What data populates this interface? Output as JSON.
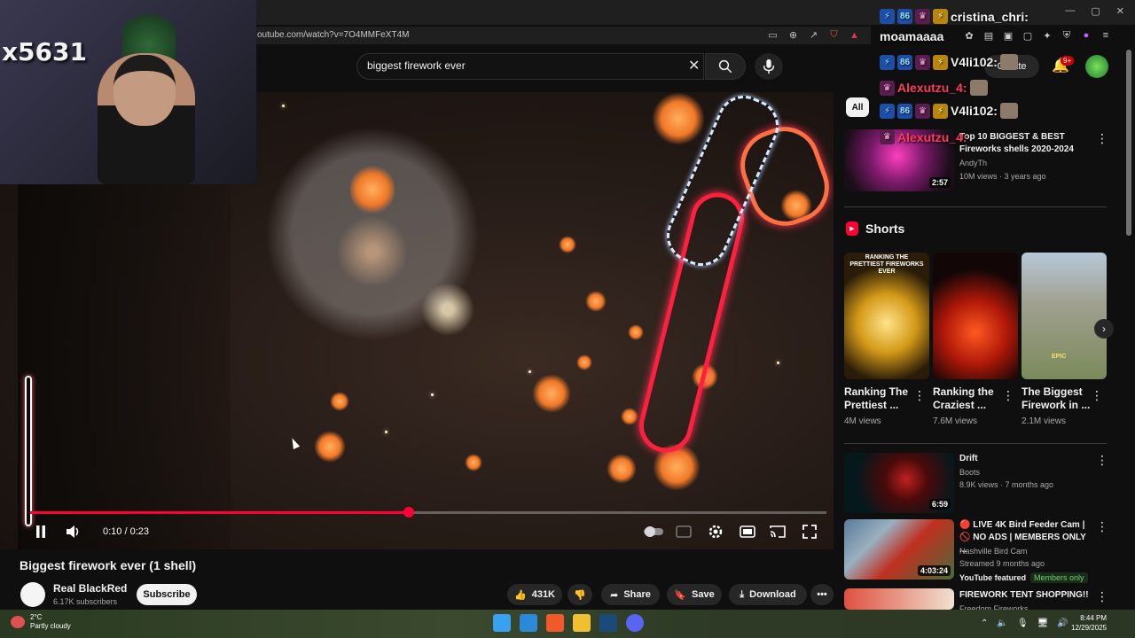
{
  "browser": {
    "url": "outube.com/watch?v=7O4MMFeXT4M"
  },
  "header": {
    "search_query": "biggest firework ever",
    "create_label": "Create",
    "notif_count": "9+"
  },
  "webcam": {
    "overlay_text": "x5631"
  },
  "player": {
    "time": "0:10 / 0:23",
    "progress_fraction": 0.476
  },
  "video": {
    "title": "Biggest firework ever (1 shell)",
    "channel": "Real BlackRed",
    "subscribers": "6.17K subscribers",
    "subscribe_label": "Subscribe",
    "likes": "431K",
    "share_label": "Share",
    "save_label": "Save",
    "download_label": "Download"
  },
  "sidebar": {
    "chip_all": "All",
    "rec1": {
      "title": "Top 10 BIGGEST & BEST Fireworks shells 2020-2024",
      "channel": "AndyTh",
      "meta": "10M views · 3 years ago",
      "duration": "2:57"
    },
    "shorts_heading": "Shorts",
    "shorts": [
      {
        "title_line1": "Ranking The",
        "title_line2": "Prettiest ...",
        "views": "4M views",
        "thumb_text": "RANKING THE PRETTIEST FIREWORKS EVER"
      },
      {
        "title_line1": "Ranking the",
        "title_line2": "Craziest ...",
        "views": "7.6M views",
        "thumb_text": ""
      },
      {
        "title_line1": "The Biggest",
        "title_line2": "Firework in ...",
        "views": "2.1M views",
        "thumb_text": "EPIC"
      }
    ],
    "rec2": {
      "title": "Drift",
      "channel": "Boots",
      "meta": "8.9K views · 7 months ago",
      "duration": "6:59"
    },
    "rec3": {
      "title_line1": "🔴 LIVE 4K Bird Feeder Cam |",
      "title_line2": "🚫 NO ADS | MEMBERS ONLY ...",
      "channel": "Nashville Bird Cam",
      "meta": "Streamed 9 months ago",
      "featured": "YouTube featured",
      "members": "Members only",
      "duration": "4:03:24"
    },
    "rec4": {
      "title": "FIREWORK TENT SHOPPING!!",
      "channel": "Freedom Fireworks"
    }
  },
  "chat": [
    {
      "user": "cristina_chri:",
      "color": "#ffffff"
    },
    {
      "user": "moamaaaa",
      "color": "#ffffff"
    },
    {
      "user": "V4li102:",
      "color": "#ffffff"
    },
    {
      "user": "Alexutzu_4:",
      "color": "#ff3b5c"
    },
    {
      "user": "V4li102:",
      "color": "#ffffff"
    },
    {
      "user": "Alexutzu_4:",
      "color": "#ff3b5c"
    }
  ],
  "taskbar": {
    "temp": "2°C",
    "weather": "Partly cloudy",
    "time": "8:44 PM",
    "date": "12/29/2025"
  }
}
